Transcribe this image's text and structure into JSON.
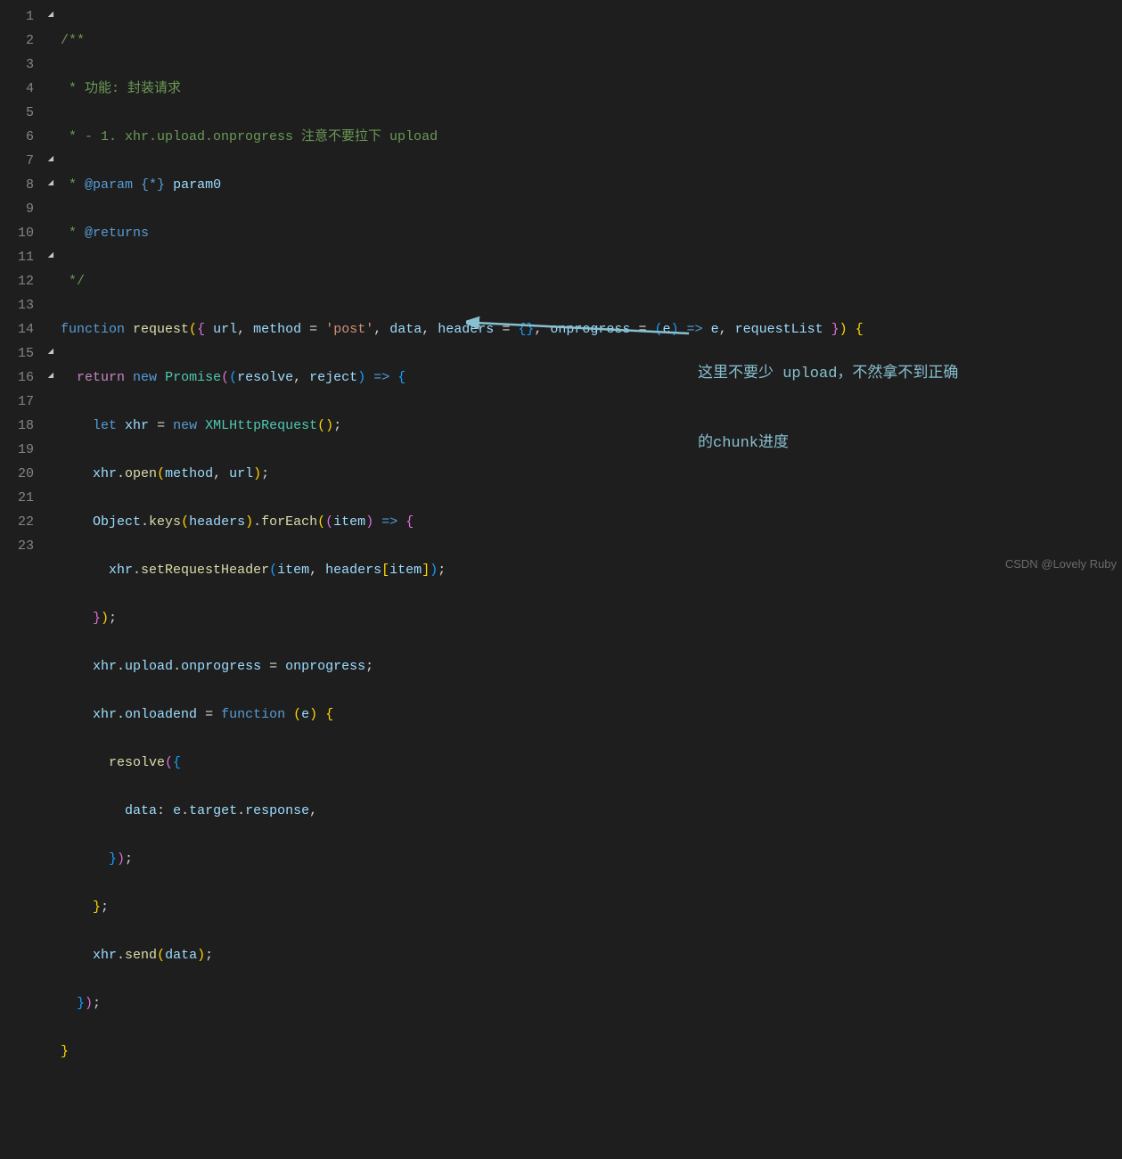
{
  "lines": {
    "count": 23,
    "fold": {
      "1": "open",
      "7": "open",
      "8": "open",
      "11": "open",
      "15": "open",
      "16": "open"
    }
  },
  "code": {
    "l1": "/**",
    "l2_prefix": " * ",
    "l2_text": "功能: 封装请求",
    "l3_prefix": " * ",
    "l3_text": "- 1. xhr.upload.onprogress 注意不要拉下 upload",
    "l4_prefix": " * ",
    "l4_tag": "@param",
    "l4_type": "{*}",
    "l4_name": "param0",
    "l5_prefix": " * ",
    "l5_tag": "@returns",
    "l6": " */",
    "l7": {
      "function": "function",
      "name": "request",
      "p_url": "url",
      "p_method": "method",
      "eq": "=",
      "post": "'post'",
      "p_data": "data",
      "p_headers": "headers",
      "headers_def": "{}",
      "p_onprogress": "onprogress",
      "arrow_fn": "(e) => e",
      "p_e": "e",
      "p_requestList": "requestList"
    },
    "l8": {
      "return": "return",
      "new": "new",
      "promise": "Promise",
      "resolve": "resolve",
      "reject": "reject"
    },
    "l9": {
      "let": "let",
      "xhr": "xhr",
      "new": "new",
      "cls": "XMLHttpRequest"
    },
    "l10": {
      "xhr": "xhr",
      "open": "open",
      "method": "method",
      "url": "url"
    },
    "l11": {
      "object": "Object",
      "keys": "keys",
      "headers": "headers",
      "forEach": "forEach",
      "item": "item"
    },
    "l12": {
      "xhr": "xhr",
      "fn": "setRequestHeader",
      "item": "item",
      "headers": "headers"
    },
    "l14": {
      "xhr": "xhr",
      "upload": "upload",
      "onprogress": "onprogress",
      "rhs": "onprogress"
    },
    "l15": {
      "xhr": "xhr",
      "onloadend": "onloadend",
      "function": "function",
      "e": "e"
    },
    "l16": {
      "resolve": "resolve"
    },
    "l17": {
      "data": "data",
      "e": "e",
      "target": "target",
      "response": "response"
    },
    "l20": {
      "xhr": "xhr",
      "send": "send",
      "data": "data"
    }
  },
  "annotation": {
    "line1": "这里不要少 upload，不然拿不到正确",
    "line2": "的chunk进度"
  },
  "watermark": "CSDN @Lovely Ruby"
}
